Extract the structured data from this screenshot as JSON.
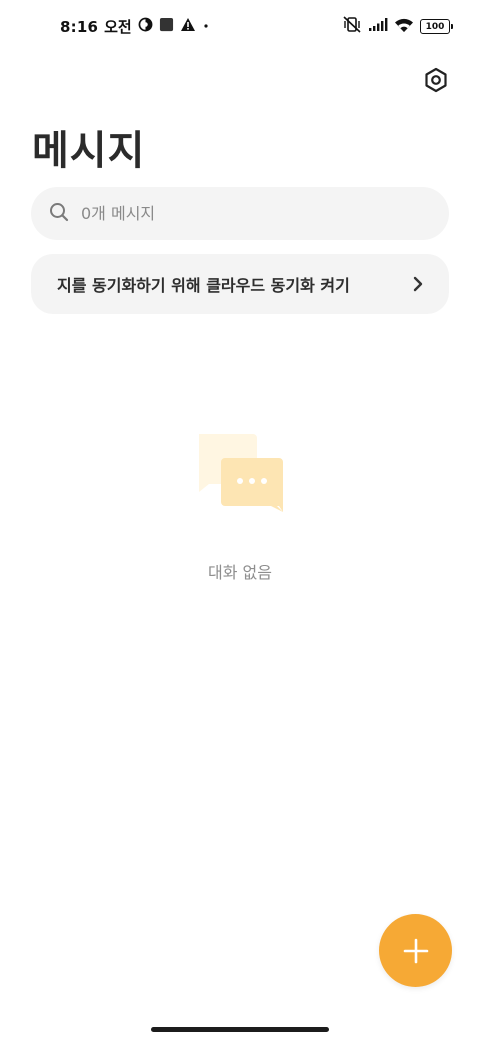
{
  "status_bar": {
    "time": "8:16",
    "ampm": "오전",
    "battery": "100"
  },
  "header": {
    "title": "메시지",
    "settings_icon": "hexagon-settings-icon"
  },
  "search": {
    "placeholder": "0개 메시지",
    "value": ""
  },
  "sync_banner": {
    "text": "지를 동기화하기 위해 클라우드 동기화 켜기"
  },
  "empty_state": {
    "text": "대화 없음",
    "icon": "chat-bubbles-icon"
  },
  "fab": {
    "icon": "plus-icon"
  },
  "colors": {
    "accent": "#f6a935",
    "surface": "#f4f4f4",
    "illustration_light": "#fff6e2",
    "illustration_main": "#fde5b3"
  }
}
